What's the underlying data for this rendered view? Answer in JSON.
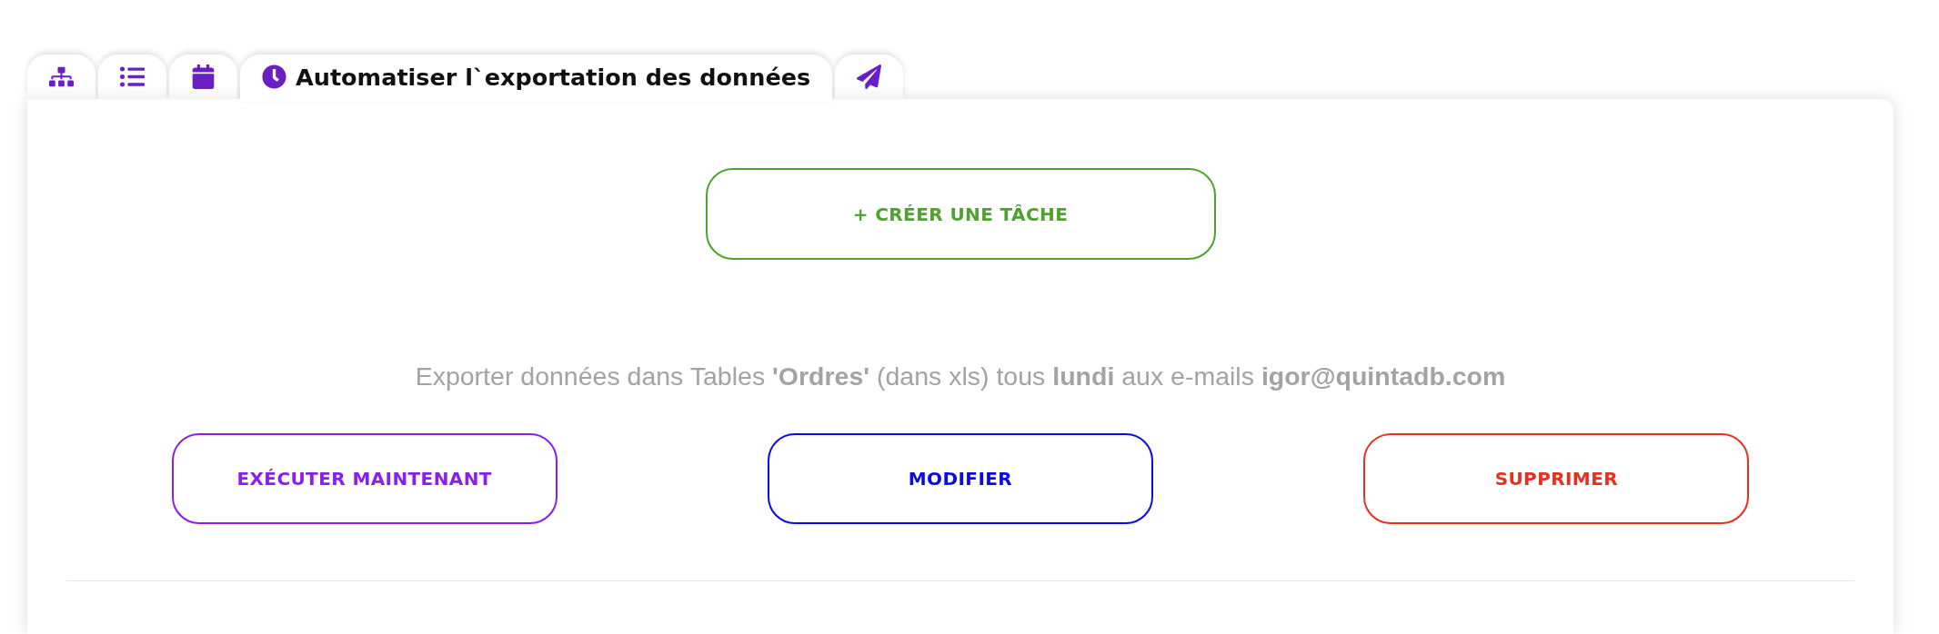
{
  "tabs": [
    {
      "selected": false
    },
    {
      "selected": false
    },
    {
      "selected": false
    },
    {
      "label": "Automatiser l`exportation des données",
      "selected": true
    },
    {
      "selected": false
    }
  ],
  "create_button": {
    "label": "+ CRÉER UNE TÂCHE"
  },
  "task": {
    "description": "Exporter données dans Tables **'Ordres'** (dans xls) tous **lundi** aux e-mails **igor@quintadb.com**"
  },
  "actions": [
    {
      "label": "EXÉCUTER MAINTENANT",
      "color": "#8a1ef2"
    },
    {
      "label": "MODIFIER",
      "color": "#0a0ae8"
    },
    {
      "label": "SUPPRIMER",
      "color": "#e8301e"
    }
  ]
}
